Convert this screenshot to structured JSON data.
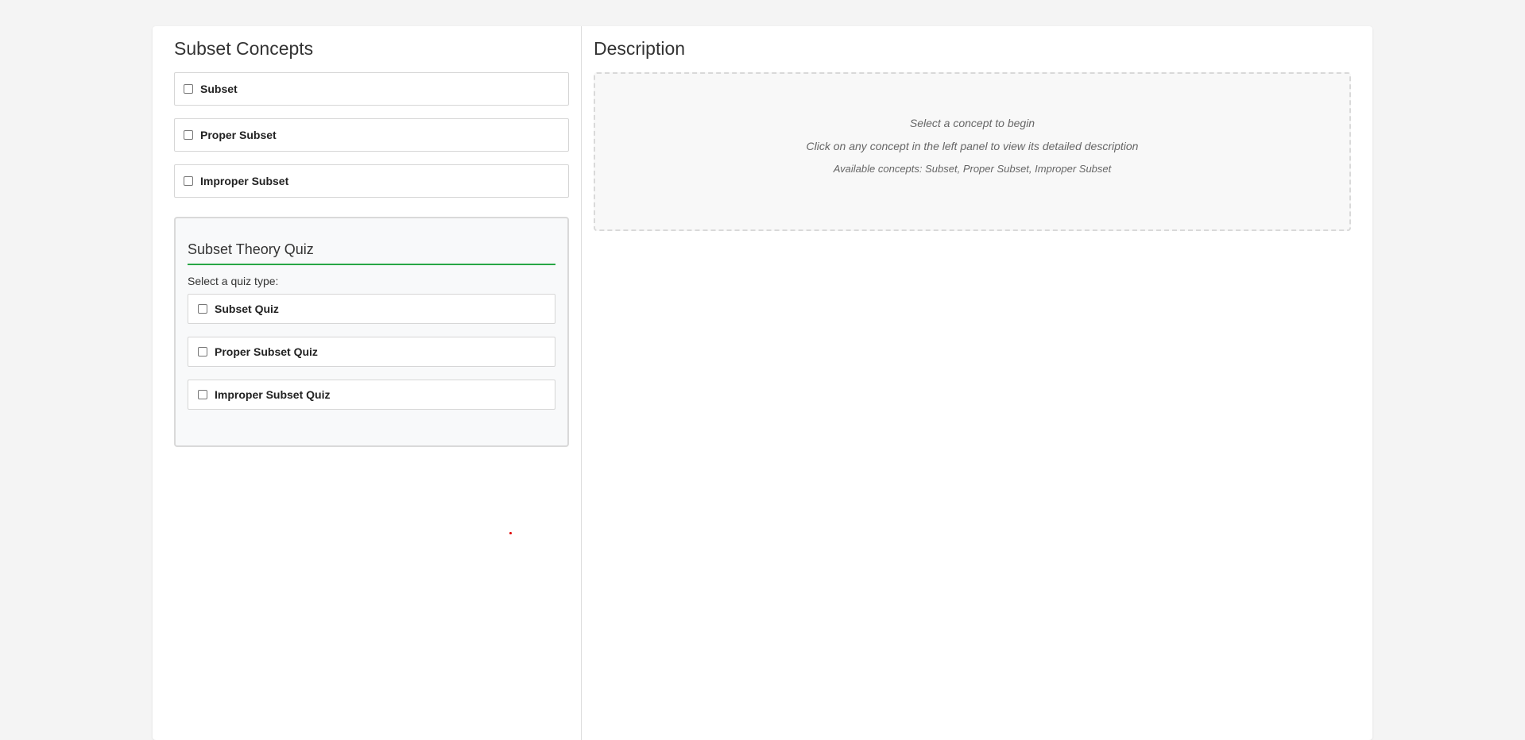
{
  "concepts": {
    "title": "Subset Concepts",
    "items": [
      {
        "label": "Subset",
        "checked": false
      },
      {
        "label": "Proper Subset",
        "checked": false
      },
      {
        "label": "Improper Subset",
        "checked": false
      }
    ]
  },
  "quiz": {
    "title": "Subset Theory Quiz",
    "prompt": "Select a quiz type:",
    "items": [
      {
        "label": "Subset Quiz",
        "checked": false
      },
      {
        "label": "Proper Subset Quiz",
        "checked": false
      },
      {
        "label": "Improper Subset Quiz",
        "checked": false
      }
    ],
    "accent_color": "#28a745"
  },
  "description": {
    "title": "Description",
    "placeholder_line1": "Select a concept to begin",
    "placeholder_line2": "Click on any concept in the left panel to view its detailed description",
    "placeholder_line3": "Available concepts: Subset, Proper Subset, Improper Subset"
  }
}
